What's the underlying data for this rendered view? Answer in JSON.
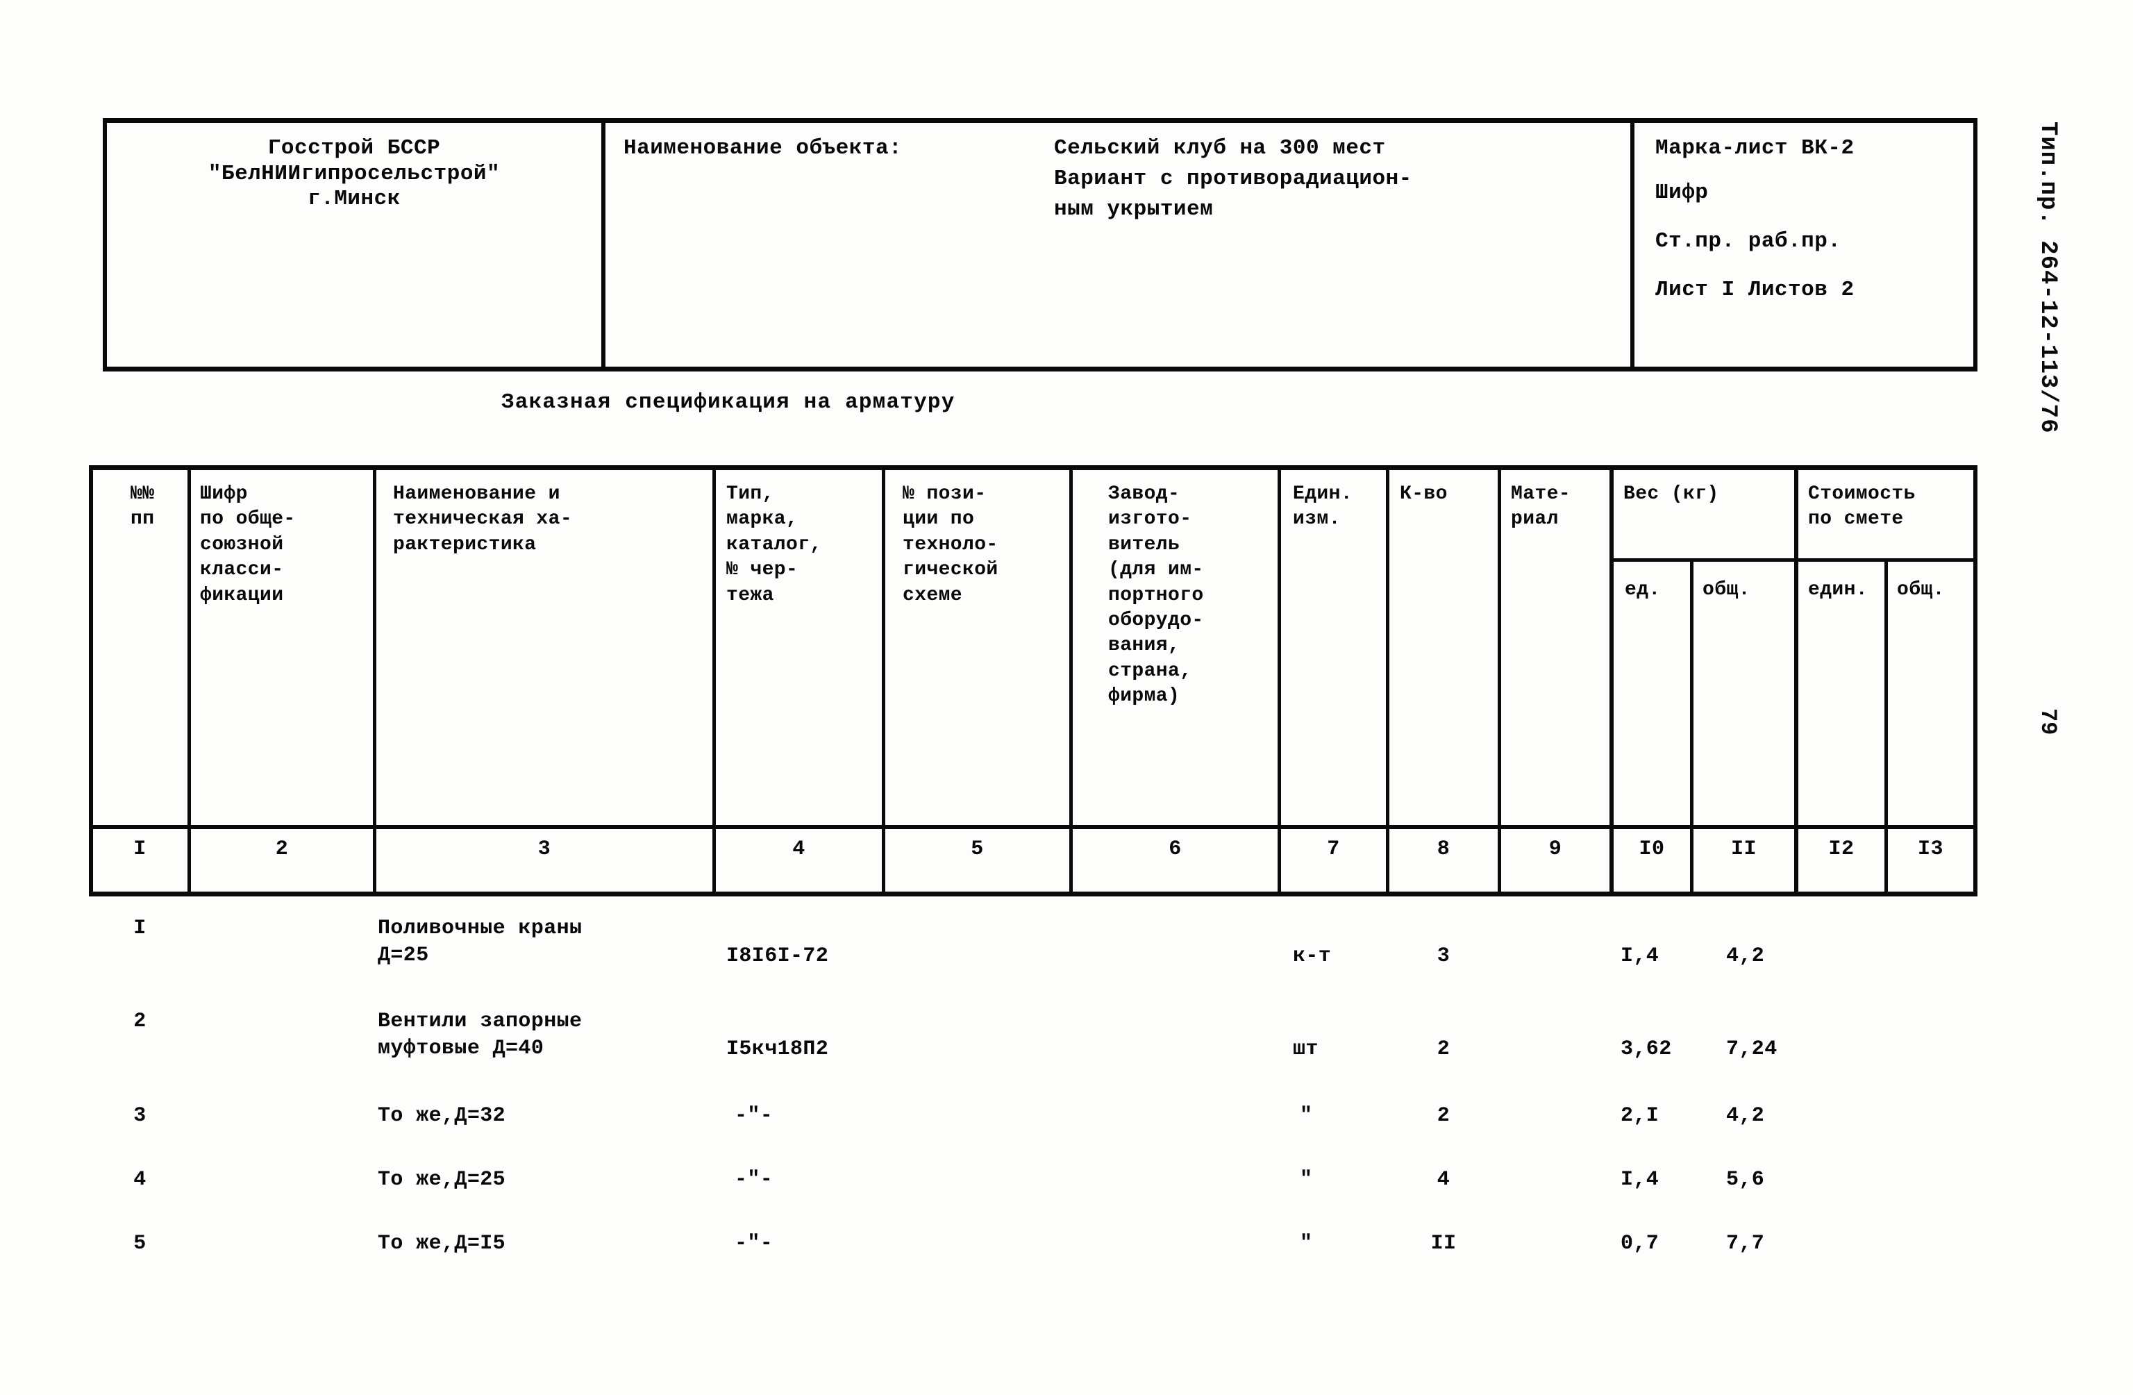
{
  "document": {
    "title_block": {
      "organization_lines": [
        "Госстрой БССР",
        "\"БелНИИгипросельстрой\"",
        "г.Минск"
      ],
      "object_label": "Наименование объекта:",
      "object_lines": [
        "Сельский клуб на 300 мест",
        "Вариант с противорадиацион-",
        "ным укрытием"
      ],
      "mark_lines": [
        "Марка-лист ВК-2",
        "Шифр",
        "Ст.пр. раб.пр.",
        "Лист I Листов 2"
      ]
    },
    "spec_title": "Заказная спецификация на арматуру",
    "margin_code": "Тип.пр. 264-12-113/76",
    "page_number": "79"
  },
  "table": {
    "headers": {
      "c1": "№№\nпп",
      "c2": "Шифр\nпо обще-\nсоюзной\nкласси-\nфикации",
      "c3": "Наименование и\nтехническая ха-\nрактеристика",
      "c4": "Тип,\nмарка,\nкаталог,\n№ чер-\nтежа",
      "c5": "№ пози-\nции по\nтехноло-\nгической\nсхеме",
      "c6": "Завод-\nизгото-\nвитель\n(для им-\nпортного\nоборудо-\nвания,\nстрана,\nфирма)",
      "c7": "Един.\nизм.",
      "c8": "К-во",
      "c9": "Мате-\nриал",
      "c10_11_group": "Вес (кг)",
      "c10": "ед.",
      "c11": "общ.",
      "c12_13_group": "Стоимость\nпо смете",
      "c12": "един.",
      "c13": "общ."
    },
    "column_numbers": [
      "I",
      "2",
      "3",
      "4",
      "5",
      "6",
      "7",
      "8",
      "9",
      "I0",
      "II",
      "I2",
      "I3"
    ],
    "rows": [
      {
        "num": "I",
        "code": "",
        "name": "Поливочные краны\nД=25",
        "type": "I8I6I-72",
        "pos": "",
        "factory": "",
        "unit": "к-т",
        "qty": "3",
        "material": "",
        "weight_unit": "I,4",
        "weight_total": "4,2",
        "cost_unit": "",
        "cost_total": ""
      },
      {
        "num": "2",
        "code": "",
        "name": "Вентили запорные\nмуфтовые Д=40",
        "type": "I5кч18П2",
        "pos": "",
        "factory": "",
        "unit": "шт",
        "qty": "2",
        "material": "",
        "weight_unit": "3,62",
        "weight_total": "7,24",
        "cost_unit": "",
        "cost_total": ""
      },
      {
        "num": "3",
        "code": "",
        "name": "То же,Д=32",
        "type": "-\"-",
        "pos": "",
        "factory": "",
        "unit": "\"",
        "qty": "2",
        "material": "",
        "weight_unit": "2,I",
        "weight_total": "4,2",
        "cost_unit": "",
        "cost_total": ""
      },
      {
        "num": "4",
        "code": "",
        "name": "То же,Д=25",
        "type": "-\"-",
        "pos": "",
        "factory": "",
        "unit": "\"",
        "qty": "4",
        "material": "",
        "weight_unit": "I,4",
        "weight_total": "5,6",
        "cost_unit": "",
        "cost_total": ""
      },
      {
        "num": "5",
        "code": "",
        "name": "То же,Д=I5",
        "type": "-\"-",
        "pos": "",
        "factory": "",
        "unit": "\"",
        "qty": "II",
        "material": "",
        "weight_unit": "0,7",
        "weight_total": "7,7",
        "cost_unit": "",
        "cost_total": ""
      }
    ]
  }
}
